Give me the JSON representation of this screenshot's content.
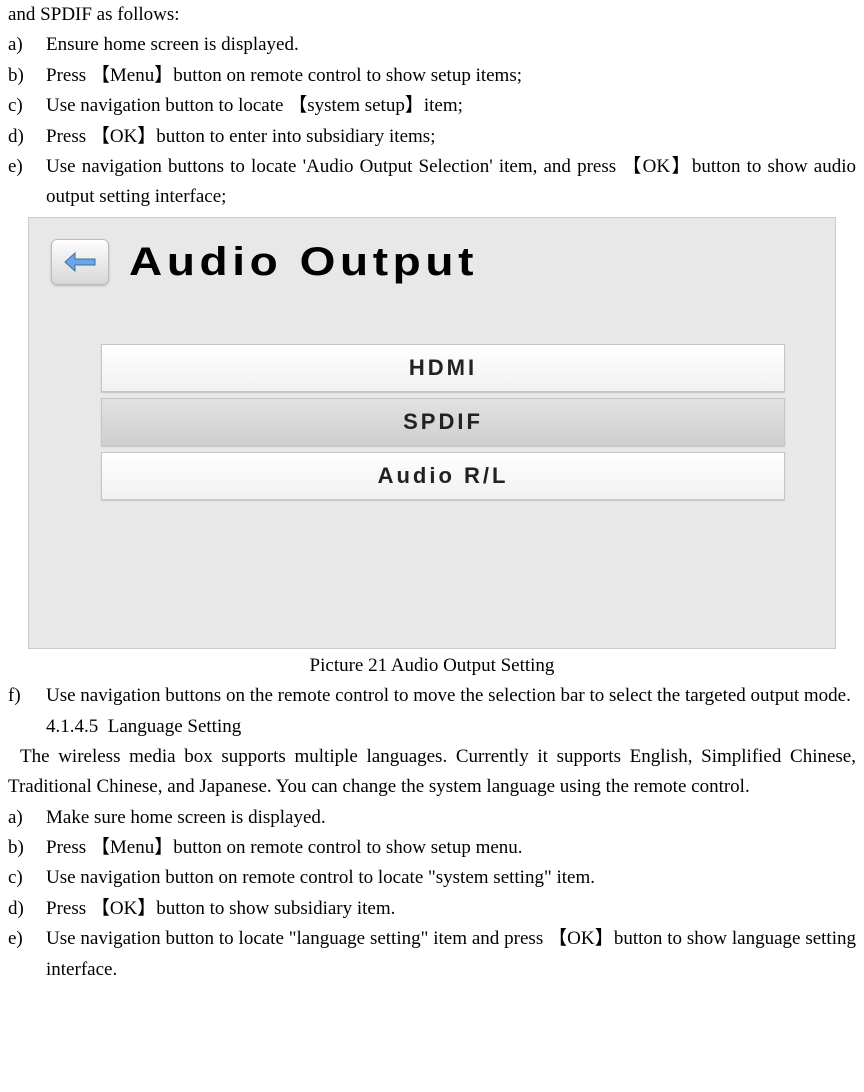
{
  "intro": "and SPDIF as follows:",
  "steps1": {
    "a": {
      "m": "a)",
      "t": "Ensure home screen is displayed."
    },
    "b": {
      "m": "b)",
      "t": "Press 【Menu】button on remote control to show setup items;"
    },
    "c": {
      "m": "c)",
      "t": "Use navigation button   to locate 【system setup】item;"
    },
    "d": {
      "m": "d)",
      "t": "Press 【OK】button to enter into subsidiary items;"
    },
    "e": {
      "m": "e)",
      "t": "Use navigation buttons to locate 'Audio Output Selection' item, and press 【OK】button to show audio output setting interface;"
    }
  },
  "figure": {
    "title": "Audio Output",
    "options": {
      "hdmi": "HDMI",
      "spdif": "SPDIF",
      "rl": "Audio R/L"
    },
    "caption": "Picture 21 Audio Output Setting"
  },
  "steps1f": {
    "m": "f)",
    "t": "Use navigation buttons on the remote control to move the selection bar to select the targeted output mode."
  },
  "section": {
    "num": "4.1.4.5",
    "title": "Language Setting"
  },
  "lang_para": "The wireless media box supports multiple languages. Currently it supports English, Simplified Chinese, Traditional Chinese, and Japanese. You can change the system language using the remote control.",
  "steps2": {
    "a": {
      "m": "a)",
      "t": "Make sure home screen is displayed."
    },
    "b": {
      "m": "b)",
      "t": "Press 【Menu】button on remote control to show setup menu."
    },
    "c": {
      "m": "c)",
      "t": "Use navigation button on remote control to locate \"system setting\" item."
    },
    "d": {
      "m": "d)",
      "t": "Press 【OK】button to show subsidiary item."
    },
    "e": {
      "m": "e)",
      "t": "Use navigation button to locate \"language setting\" item and press 【OK】button to show language setting interface."
    }
  }
}
